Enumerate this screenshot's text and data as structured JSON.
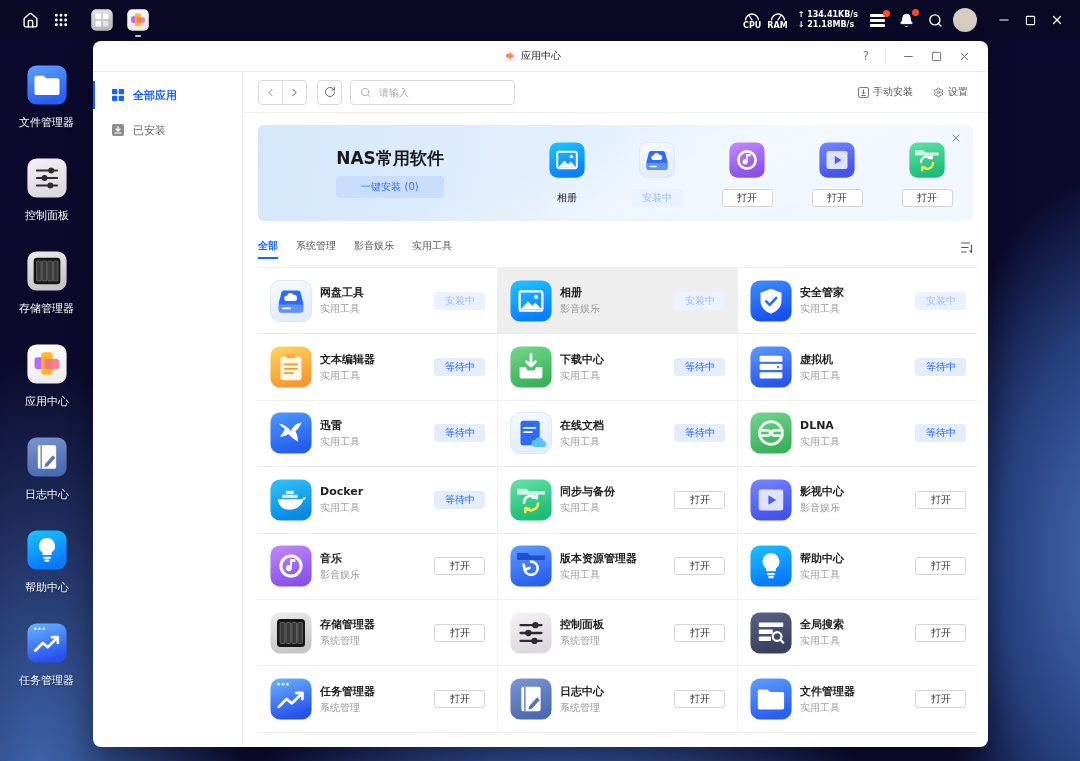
{
  "top_bar": {
    "taskbar_apps": [
      {
        "running": false
      },
      {
        "running": true
      }
    ],
    "cpu_label": "CPU",
    "ram_label": "RAM",
    "upload": "↑ 134.41KB/s",
    "download": "↓ 21.18MB/s",
    "storage_alert": true,
    "notification_alert": true
  },
  "desktop_icons": [
    {
      "label": "文件管理器"
    },
    {
      "label": "控制面板"
    },
    {
      "label": "存储管理器"
    },
    {
      "label": "应用中心"
    },
    {
      "label": "日志中心"
    },
    {
      "label": "帮助中心"
    },
    {
      "label": "任务管理器"
    }
  ],
  "window": {
    "title": "应用中心",
    "help": "?"
  },
  "sidebar": {
    "items": [
      {
        "label": "全部应用",
        "selected": true
      },
      {
        "label": "已安装",
        "selected": false
      }
    ]
  },
  "toolbar": {
    "search": {
      "placeholder": "请输入"
    },
    "actions": [
      "手动安装",
      "设置"
    ]
  },
  "banner": {
    "title": "NAS常用软件",
    "install_button": {
      "label": "一键安装 (0)",
      "disabled": true
    },
    "apps": [
      {
        "kind": "name",
        "label": "相册"
      },
      {
        "kind": "installing",
        "label": "安装中"
      },
      {
        "kind": "open",
        "label": "打开"
      },
      {
        "kind": "open",
        "label": "打开"
      },
      {
        "kind": "open",
        "label": "打开"
      }
    ]
  },
  "tabs": [
    {
      "label": "全部",
      "selected": true
    },
    {
      "label": "系统管理",
      "selected": false
    },
    {
      "label": "影音娱乐",
      "selected": false
    },
    {
      "label": "实用工具",
      "selected": false
    }
  ],
  "apps": [
    {
      "name": "网盘工具",
      "category": "实用工具",
      "kind": "installing",
      "button": "安装中",
      "highlighted": false
    },
    {
      "name": "相册",
      "category": "影音娱乐",
      "kind": "installing",
      "button": "安装中",
      "highlighted": true
    },
    {
      "name": "安全管家",
      "category": "实用工具",
      "kind": "installing",
      "button": "安装中",
      "highlighted": false
    },
    {
      "name": "文本编辑器",
      "category": "实用工具",
      "kind": "waiting",
      "button": "等待中",
      "highlighted": false
    },
    {
      "name": "下载中心",
      "category": "实用工具",
      "kind": "waiting",
      "button": "等待中",
      "highlighted": false
    },
    {
      "name": "虚拟机",
      "category": "实用工具",
      "kind": "waiting",
      "button": "等待中",
      "highlighted": false
    },
    {
      "name": "迅雷",
      "category": "实用工具",
      "kind": "waiting",
      "button": "等待中",
      "highlighted": false
    },
    {
      "name": "在线文档",
      "category": "实用工具",
      "kind": "waiting",
      "button": "等待中",
      "highlighted": false
    },
    {
      "name": "DLNA",
      "category": "实用工具",
      "kind": "waiting",
      "button": "等待中",
      "highlighted": false
    },
    {
      "name": "Docker",
      "category": "实用工具",
      "kind": "waiting",
      "button": "等待中",
      "highlighted": false
    },
    {
      "name": "同步与备份",
      "category": "实用工具",
      "kind": "open",
      "button": "打开",
      "highlighted": false
    },
    {
      "name": "影视中心",
      "category": "影音娱乐",
      "kind": "open",
      "button": "打开",
      "highlighted": false
    },
    {
      "name": "音乐",
      "category": "影音娱乐",
      "kind": "open",
      "button": "打开",
      "highlighted": false
    },
    {
      "name": "版本资源管理器",
      "category": "实用工具",
      "kind": "open",
      "button": "打开",
      "highlighted": false
    },
    {
      "name": "帮助中心",
      "category": "实用工具",
      "kind": "open",
      "button": "打开",
      "highlighted": false
    },
    {
      "name": "存储管理器",
      "category": "系统管理",
      "kind": "open",
      "button": "打开",
      "highlighted": false
    },
    {
      "name": "控制面板",
      "category": "系统管理",
      "kind": "open",
      "button": "打开",
      "highlighted": false
    },
    {
      "name": "全局搜索",
      "category": "实用工具",
      "kind": "open",
      "button": "打开",
      "highlighted": false
    },
    {
      "name": "任务管理器",
      "category": "系统管理",
      "kind": "open",
      "button": "打开",
      "highlighted": false
    },
    {
      "name": "日志中心",
      "category": "系统管理",
      "kind": "open",
      "button": "打开",
      "highlighted": false
    },
    {
      "name": "文件管理器",
      "category": "实用工具",
      "kind": "open",
      "button": "打开",
      "highlighted": false
    }
  ]
}
